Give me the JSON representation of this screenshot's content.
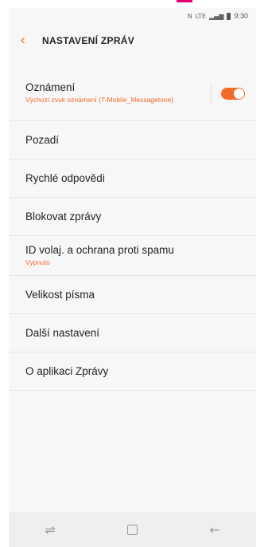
{
  "status_bar": {
    "icons": [
      "nfc-icon",
      "lte-icon",
      "signal-icon",
      "battery-icon"
    ],
    "nfc": "N",
    "lte": "LTE",
    "time": "9:30"
  },
  "header": {
    "back_icon": "‹",
    "title": "NASTAVENÍ ZPRÁV"
  },
  "settings": {
    "notifications": {
      "label": "Oznámení",
      "subtitle": "Výchozí zvuk oznámení (T-Mobile_Messagetone)",
      "toggle_on": true
    },
    "background": {
      "label": "Pozadí"
    },
    "quick_replies": {
      "label": "Rychlé odpovědi"
    },
    "block_messages": {
      "label": "Blokovat zprávy"
    },
    "caller_id": {
      "label": "ID volaj. a ochrana proti spamu",
      "subtitle": "Vypnuto"
    },
    "font_size": {
      "label": "Velikost písma"
    },
    "more_settings": {
      "label": "Další nastavení"
    },
    "about": {
      "label": "O aplikaci Zprávy"
    }
  },
  "nav_bar": {
    "recent_apps_icon": "recent-apps-icon",
    "home_icon": "home-icon",
    "back_icon": "back-icon"
  },
  "colors": {
    "accent": "#f26b2a",
    "brand": "#e20074"
  }
}
